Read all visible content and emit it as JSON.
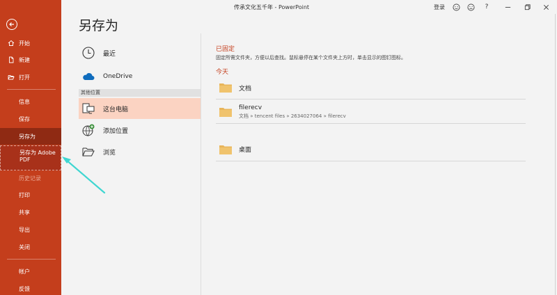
{
  "titlebar": {
    "title": "传承文化五千年 - PowerPoint",
    "login": "登录",
    "icons": [
      "smiley-icon",
      "frown-icon",
      "help-icon",
      "minimize-icon",
      "restore-icon",
      "close-icon"
    ],
    "help": "?"
  },
  "sidebar": {
    "items": [
      {
        "label": "开始",
        "icon": "home-icon"
      },
      {
        "label": "新建",
        "icon": "new-file-icon"
      },
      {
        "label": "打开",
        "icon": "folder-open-icon"
      },
      {
        "label": "信息"
      },
      {
        "label": "保存"
      },
      {
        "label": "另存为",
        "active": true
      },
      {
        "label": "另存为 Adobe PDF",
        "highlighted": true
      },
      {
        "label": "历史记录",
        "disabled": true
      },
      {
        "label": "打印"
      },
      {
        "label": "共享"
      },
      {
        "label": "导出"
      },
      {
        "label": "关闭"
      },
      {
        "label": "帐户"
      },
      {
        "label": "反馈"
      }
    ]
  },
  "page": {
    "title": "另存为"
  },
  "locations": {
    "recent": "最近",
    "onedrive": "OneDrive",
    "other_label": "其他位置",
    "this_pc": "这台电脑",
    "add_place": "添加位置",
    "browse": "浏览"
  },
  "pinned": {
    "title": "已固定",
    "desc": "固定所需文件夹，方便以后查找。鼠标悬停在某个文件夹上方时，单击显示的图钉图标。"
  },
  "today": {
    "title": "今天",
    "folders": [
      {
        "name": "文档",
        "path": ""
      },
      {
        "name": "filerecv",
        "path": "文档 » tencent files » 2634027064 » filerecv"
      },
      {
        "name": "桌面",
        "path": ""
      }
    ]
  },
  "colors": {
    "sidebar": "#c43e1c",
    "sidebar_active": "#8f2a13",
    "selected_location": "#fbd3c2",
    "accent_text": "#c43e1c",
    "folder": "#f0c36d",
    "annotation_arrow": "#3fd6d1"
  }
}
